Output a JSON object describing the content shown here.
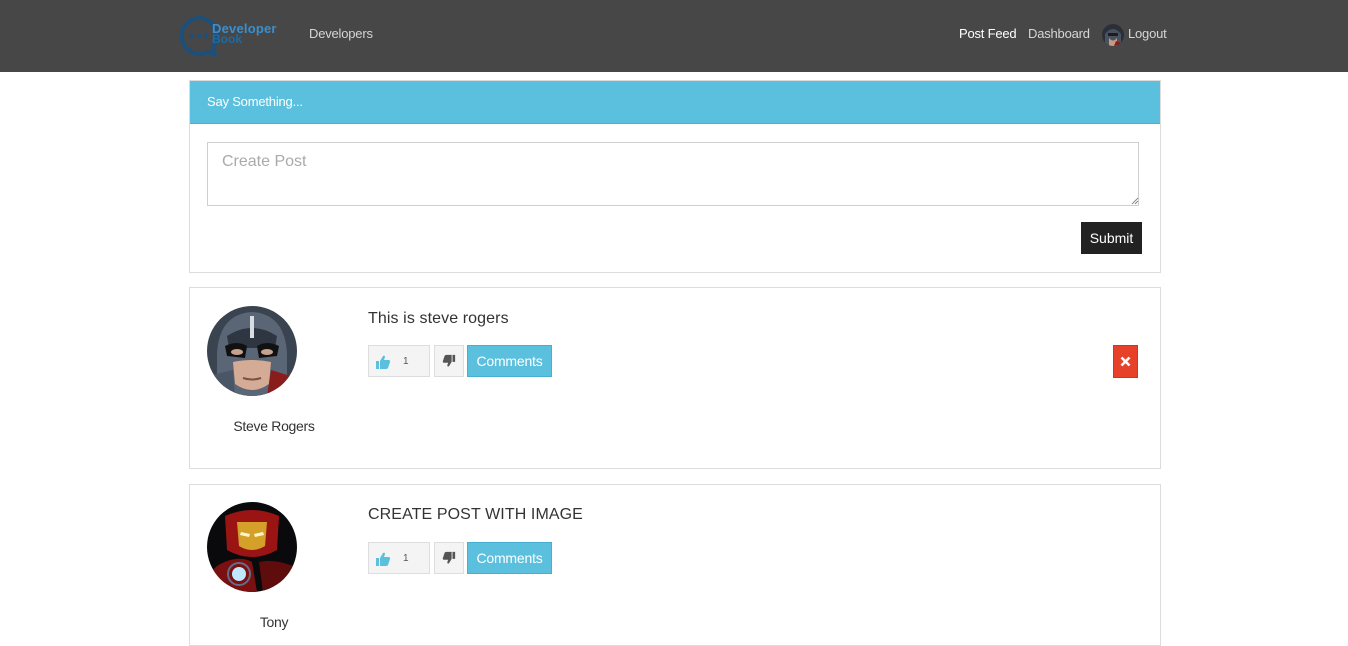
{
  "navbar": {
    "brand": {
      "line1": "Developer",
      "line2": "Book",
      "icon": "chat-bubble-logo"
    },
    "developers_link": "Developers",
    "post_feed_link": "Post Feed",
    "dashboard_link": "Dashboard",
    "logout_link": "Logout"
  },
  "create_post": {
    "header": "Say Something...",
    "placeholder": "Create Post",
    "value": "",
    "submit_label": "Submit"
  },
  "posts": [
    {
      "text": "This is steve rogers",
      "author": "Steve Rogers",
      "likes": "1",
      "comments_label": "Comments",
      "can_delete": true,
      "avatar": "captain-america-avatar"
    },
    {
      "text": "CREATE POST WITH IMAGE",
      "author": "Tony",
      "likes": "1",
      "comments_label": "Comments",
      "can_delete": false,
      "avatar": "iron-man-avatar"
    }
  ],
  "colors": {
    "navbar": "#474747",
    "accent": "#5bc0de",
    "delete": "#e8412a",
    "submit": "#222222",
    "like_icon": "#5bc0de",
    "dislike_icon": "#555555"
  }
}
